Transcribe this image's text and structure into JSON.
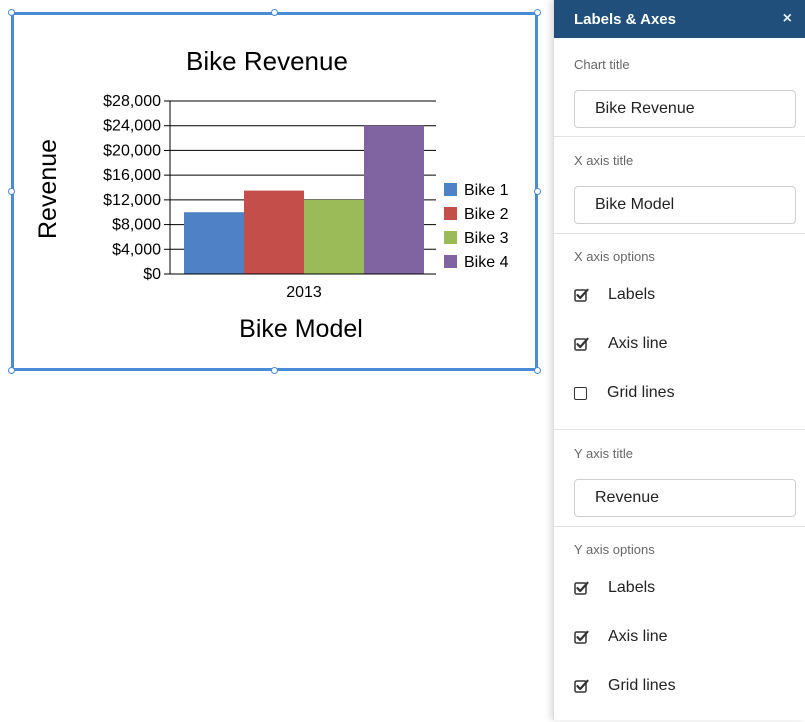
{
  "chart_data": {
    "type": "bar",
    "title": "Bike Revenue",
    "xlabel": "Bike Model",
    "ylabel": "Revenue",
    "categories": [
      "2013"
    ],
    "ylim": [
      0,
      28000
    ],
    "yticks": [
      "$0",
      "$4,000",
      "$8,000",
      "$12,000",
      "$16,000",
      "$20,000",
      "$24,000",
      "$28,000"
    ],
    "grid": true,
    "legend_position": "right",
    "series": [
      {
        "name": "Bike 1",
        "values": [
          10000
        ],
        "color": "#4f81c7"
      },
      {
        "name": "Bike 2",
        "values": [
          13500
        ],
        "color": "#c44f4a"
      },
      {
        "name": "Bike 3",
        "values": [
          12000
        ],
        "color": "#9bbb59"
      },
      {
        "name": "Bike 4",
        "values": [
          24000
        ],
        "color": "#8064a2"
      }
    ]
  },
  "panel": {
    "title": "Labels & Axes",
    "close_icon": "×",
    "chart_title_label": "Chart title",
    "chart_title_value": "Bike Revenue",
    "x_axis_title_label": "X axis title",
    "x_axis_title_value": "Bike Model",
    "x_axis_options_label": "X axis options",
    "x_options": [
      {
        "label": "Labels",
        "checked": true
      },
      {
        "label": "Axis line",
        "checked": true
      },
      {
        "label": "Grid lines",
        "checked": false
      }
    ],
    "y_axis_title_label": "Y axis title",
    "y_axis_title_value": "Revenue",
    "y_axis_options_label": "Y axis options",
    "y_options": [
      {
        "label": "Labels",
        "checked": true
      },
      {
        "label": "Axis line",
        "checked": true
      },
      {
        "label": "Grid lines",
        "checked": true
      }
    ]
  },
  "colors": {
    "selection": "#4a8bd6",
    "panel_header": "#1f4f7a"
  }
}
